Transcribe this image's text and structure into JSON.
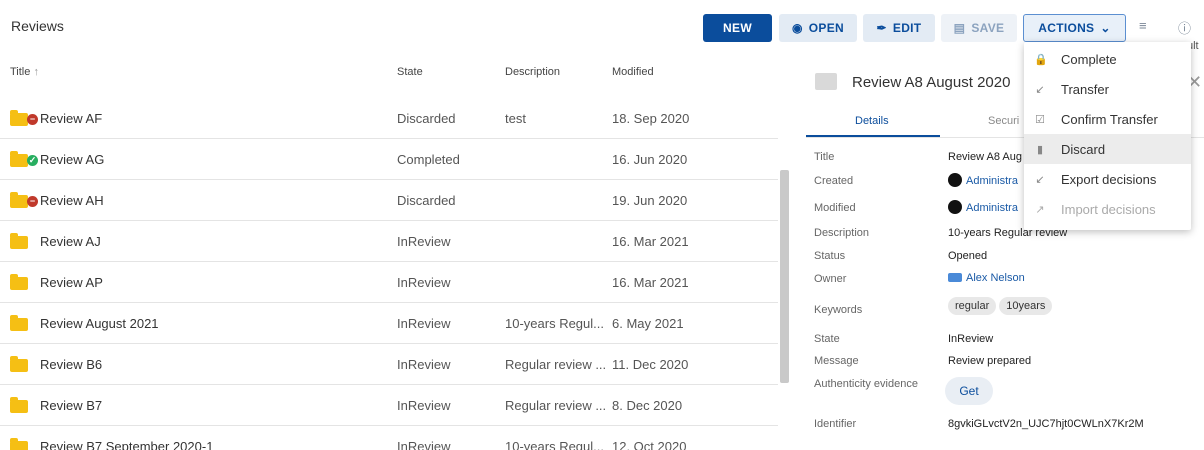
{
  "page": {
    "title": "Reviews"
  },
  "toolbar": {
    "new_label": "NEW",
    "open_label": "OPEN",
    "edit_label": "EDIT",
    "save_label": "SAVE",
    "actions_label": "ACTIONS",
    "clipped_text": "ult"
  },
  "table": {
    "headers": {
      "title": "Title",
      "state": "State",
      "description": "Description",
      "modified": "Modified"
    },
    "rows": [
      {
        "name": "Review AF",
        "state": "Discarded",
        "description": "test",
        "modified": "18. Sep 2020",
        "status": "discarded"
      },
      {
        "name": "Review AG",
        "state": "Completed",
        "description": "",
        "modified": "16. Jun 2020",
        "status": "completed"
      },
      {
        "name": "Review AH",
        "state": "Discarded",
        "description": "",
        "modified": "19. Jun 2020",
        "status": "discarded"
      },
      {
        "name": "Review AJ",
        "state": "InReview",
        "description": "",
        "modified": "16. Mar 2021",
        "status": ""
      },
      {
        "name": "Review AP",
        "state": "InReview",
        "description": "",
        "modified": "16. Mar 2021",
        "status": ""
      },
      {
        "name": "Review August 2021",
        "state": "InReview",
        "description": "10-years Regul...",
        "modified": "6. May 2021",
        "status": ""
      },
      {
        "name": "Review B6",
        "state": "InReview",
        "description": "Regular review ...",
        "modified": "11. Dec 2020",
        "status": ""
      },
      {
        "name": "Review B7",
        "state": "InReview",
        "description": "Regular review ...",
        "modified": "8. Dec 2020",
        "status": ""
      },
      {
        "name": "Review B7 September 2020-1",
        "state": "InReview",
        "description": "10-years Regul...",
        "modified": "12. Oct 2020",
        "status": ""
      }
    ]
  },
  "details": {
    "title": "Review A8 August 2020",
    "tabs": [
      "Details",
      "Securi"
    ],
    "fields": {
      "title_label": "Title",
      "title_value": "Review A8 Aug",
      "created_label": "Created",
      "created_value": "Administra",
      "modified_label": "Modified",
      "modified_value": "Administra",
      "description_label": "Description",
      "description_value": "10-years Regular review",
      "status_label": "Status",
      "status_value": "Opened",
      "owner_label": "Owner",
      "owner_value": "Alex Nelson",
      "keywords_label": "Keywords",
      "keywords": [
        "regular",
        "10years"
      ],
      "state_label": "State",
      "state_value": "InReview",
      "message_label": "Message",
      "message_value": "Review prepared",
      "authenticity_label": "Authenticity evidence",
      "get_label": "Get",
      "identifier_label": "Identifier",
      "identifier_value": "8gvkiGLvctV2n_UJC7hjt0CWLnX7Kr2M"
    }
  },
  "actions_menu": {
    "items": [
      {
        "label": "Complete",
        "icon": "lock-icon"
      },
      {
        "label": "Transfer",
        "icon": "arrow-down-left-icon"
      },
      {
        "label": "Confirm Transfer",
        "icon": "check-box-icon"
      },
      {
        "label": "Discard",
        "icon": "trash-icon"
      },
      {
        "label": "Export decisions",
        "icon": "arrow-down-left-icon"
      },
      {
        "label": "Import decisions",
        "icon": "arrow-up-right-icon"
      }
    ]
  },
  "colors": {
    "primary": "#0b4d9c",
    "folder": "#f5bf14",
    "discarded": "#c0392b",
    "completed": "#27ae60"
  }
}
